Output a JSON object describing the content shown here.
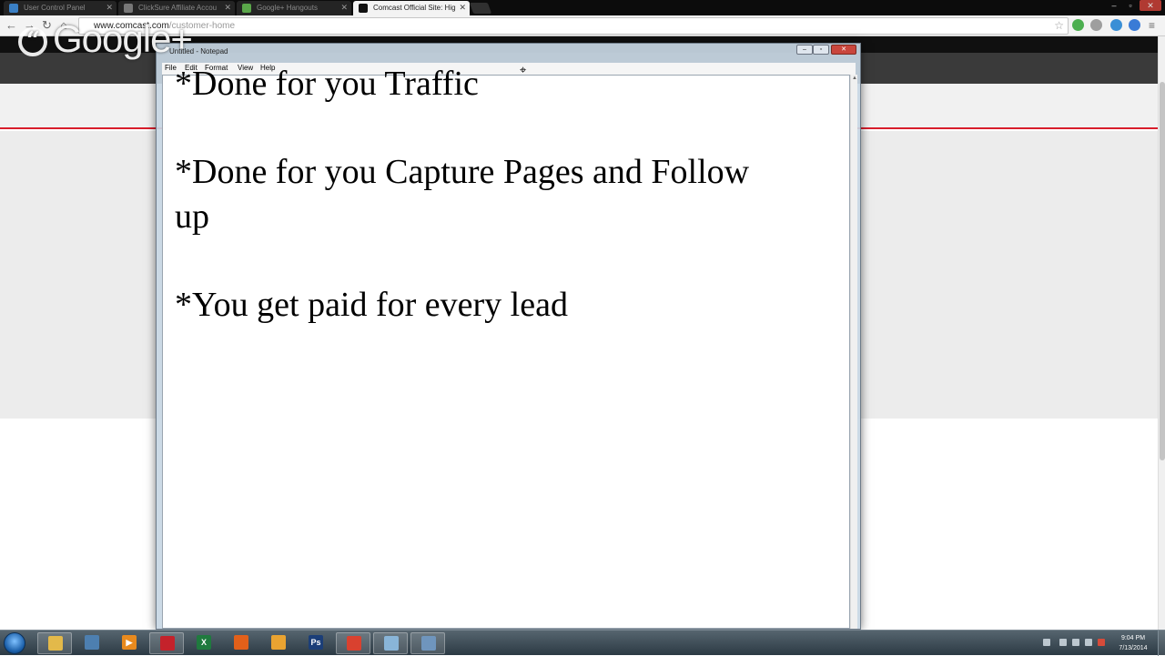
{
  "browser": {
    "tabs": [
      {
        "label": "User Control Panel",
        "active": false,
        "icon_color": "#3a7fc4"
      },
      {
        "label": "ClickSure Affiliate Accou",
        "active": false,
        "icon_color": "#777777"
      },
      {
        "label": "Google+ Hangouts",
        "active": false,
        "icon_color": "#5aa64a"
      },
      {
        "label": "Comcast Official Site: Hig",
        "active": true,
        "icon_color": "#111111"
      }
    ],
    "address": {
      "host": "www.comcast.com",
      "path": "/customer-home"
    },
    "overlay_logo": "Google+"
  },
  "notepad": {
    "title": "Untitled - Notepad",
    "menu": [
      "File",
      "Edit",
      "Format",
      "View",
      "Help"
    ],
    "lines": [
      "*Done for you Traffic",
      "*Done for you Capture Pages and Follow",
      "up",
      "*You get paid for every lead"
    ]
  },
  "taskbar": {
    "apps": [
      {
        "name": "file-explorer",
        "color": "#e3b94a"
      },
      {
        "name": "network-app",
        "color": "#4d7fb0"
      },
      {
        "name": "media-player",
        "color": "#e88a1e"
      },
      {
        "name": "red-app",
        "color": "#c4222b"
      },
      {
        "name": "excel",
        "color": "#1f7a3e"
      },
      {
        "name": "firefox",
        "color": "#e2601a"
      },
      {
        "name": "shield-app",
        "color": "#e9a331"
      },
      {
        "name": "photoshop",
        "color": "#1b3e78"
      },
      {
        "name": "chrome",
        "color": "#d9412f"
      },
      {
        "name": "notepad",
        "color": "#89b5d8"
      },
      {
        "name": "calculator",
        "color": "#6f95bd"
      }
    ],
    "clock": {
      "time": "9:04 PM",
      "date": "7/13/2014"
    }
  }
}
